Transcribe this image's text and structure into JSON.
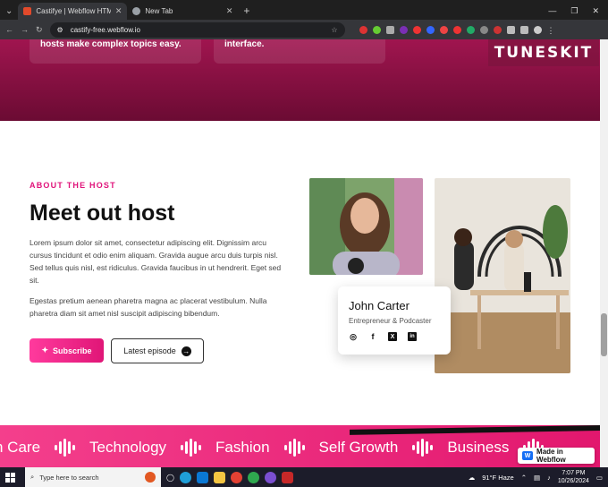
{
  "browser": {
    "tabs": [
      {
        "title": "Castifye | Webflow HTML website",
        "active": true,
        "color": "#e24a2b"
      },
      {
        "title": "New Tab",
        "active": false,
        "color": "#9aa0a6"
      }
    ],
    "new_tab": "+",
    "url": "castify-free.webflow.io"
  },
  "hero": {
    "card1_text": "hosts make complex topics easy.",
    "card2_text": "interface.",
    "watermark": "TUNESKIT"
  },
  "about": {
    "eyebrow": "ABOUT THE HOST",
    "heading": "Meet out host",
    "paragraph1": "Lorem ipsum dolor sit amet, consectetur adipiscing elit. Dignissim arcu cursus tincidunt et odio enim aliquam. Gravida augue arcu duis turpis nisl. Sed tellus quis nisl, est ridiculus. Gravida faucibus in ut hendrerit. Eget sed sit.",
    "paragraph2": " Egestas pretium aenean pharetra magna ac placerat vestibulum. Nulla pharetra diam sit amet nisl suscipit adipiscing bibendum.",
    "subscribe_label": "Subscribe",
    "latest_label": "Latest episode",
    "host_name": "John Carter",
    "host_role": "Entrepreneur & Podcaster",
    "socials": [
      "instagram-icon",
      "facebook-icon",
      "x-icon",
      "linkedin-icon"
    ],
    "accent": "#e0137a"
  },
  "marquee": {
    "words": [
      "n Care",
      "Technology",
      "Fashion",
      "Self Growth",
      "Business"
    ]
  },
  "webflow_badge": "Made in Webflow",
  "taskbar": {
    "search_placeholder": "Type here to search",
    "weather": "91°F  Haze",
    "time": "7:07 PM",
    "date": "10/26/2024"
  }
}
